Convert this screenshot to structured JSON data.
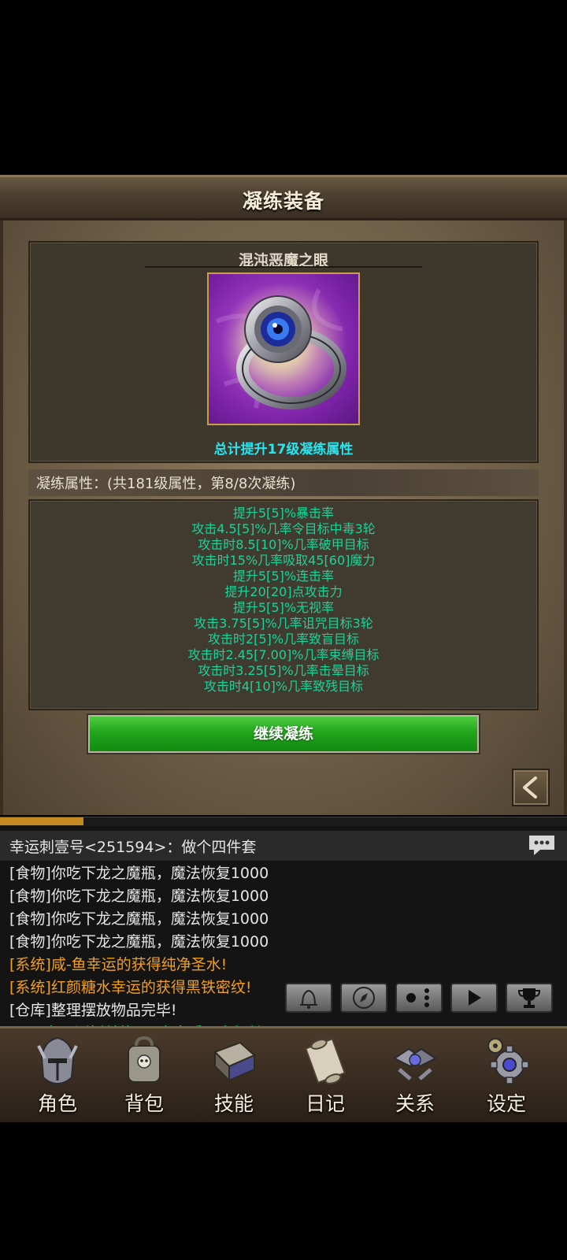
{
  "title": "凝练装备",
  "item": {
    "name": "混沌恶魔之眼",
    "total_bonus": "总计提升17级凝练属性"
  },
  "attributes": {
    "header": "凝练属性：(共181级属性，第8/8次凝练)",
    "lines": [
      "提升5[5]%暴击率",
      "攻击4.5[5]%几率令目标中毒3轮",
      "攻击时8.5[10]%几率破甲目标",
      "攻击时15%几率吸取45[60]魔力",
      "提升5[5]%连击率",
      "提升20[20]点攻击力",
      "提升5[5]%无视率",
      "攻击3.75[5]%几率诅咒目标3轮",
      "攻击时2[5]%几率致盲目标",
      "攻击时2.45[7.00]%几率束缚目标",
      "攻击时3.25[5]%几率击晕目标",
      "攻击时4[10]%几率致残目标"
    ]
  },
  "continue_button": "继续凝练",
  "chat": {
    "header": "幸运刺壹号<251594>：做个四件套",
    "messages": [
      {
        "text": "[食物]你吃下龙之魔瓶，魔法恢复1000",
        "color": "#e6e6e6"
      },
      {
        "text": "[食物]你吃下龙之魔瓶，魔法恢复1000",
        "color": "#e6e6e6"
      },
      {
        "text": "[食物]你吃下龙之魔瓶，魔法恢复1000",
        "color": "#e6e6e6"
      },
      {
        "text": "[食物]你吃下龙之魔瓶，魔法恢复1000",
        "color": "#e6e6e6"
      },
      {
        "text": "[系统]咸-鱼幸运的获得纯净圣水!",
        "color": "#f0a020"
      },
      {
        "text": "[系统]红颜糖水幸运的获得黑铁密纹!",
        "color": "#f0a020"
      },
      {
        "text": "[仓库]整理摆放物品完毕!",
        "color": "#e6e6e6"
      },
      {
        "text": "[VIP]在圣涎树兑换VIP点享受更多权益!",
        "color": "#30d060"
      }
    ]
  },
  "controls": [
    "bell-icon",
    "compass-icon",
    "dots-icon",
    "play-icon",
    "trophy-icon"
  ],
  "nav": [
    {
      "label": "角色",
      "icon": "helmet-icon"
    },
    {
      "label": "背包",
      "icon": "backpack-icon"
    },
    {
      "label": "技能",
      "icon": "skill-book-icon"
    },
    {
      "label": "日记",
      "icon": "scroll-icon"
    },
    {
      "label": "关系",
      "icon": "handshake-icon"
    },
    {
      "label": "设定",
      "icon": "gear-icon"
    }
  ]
}
